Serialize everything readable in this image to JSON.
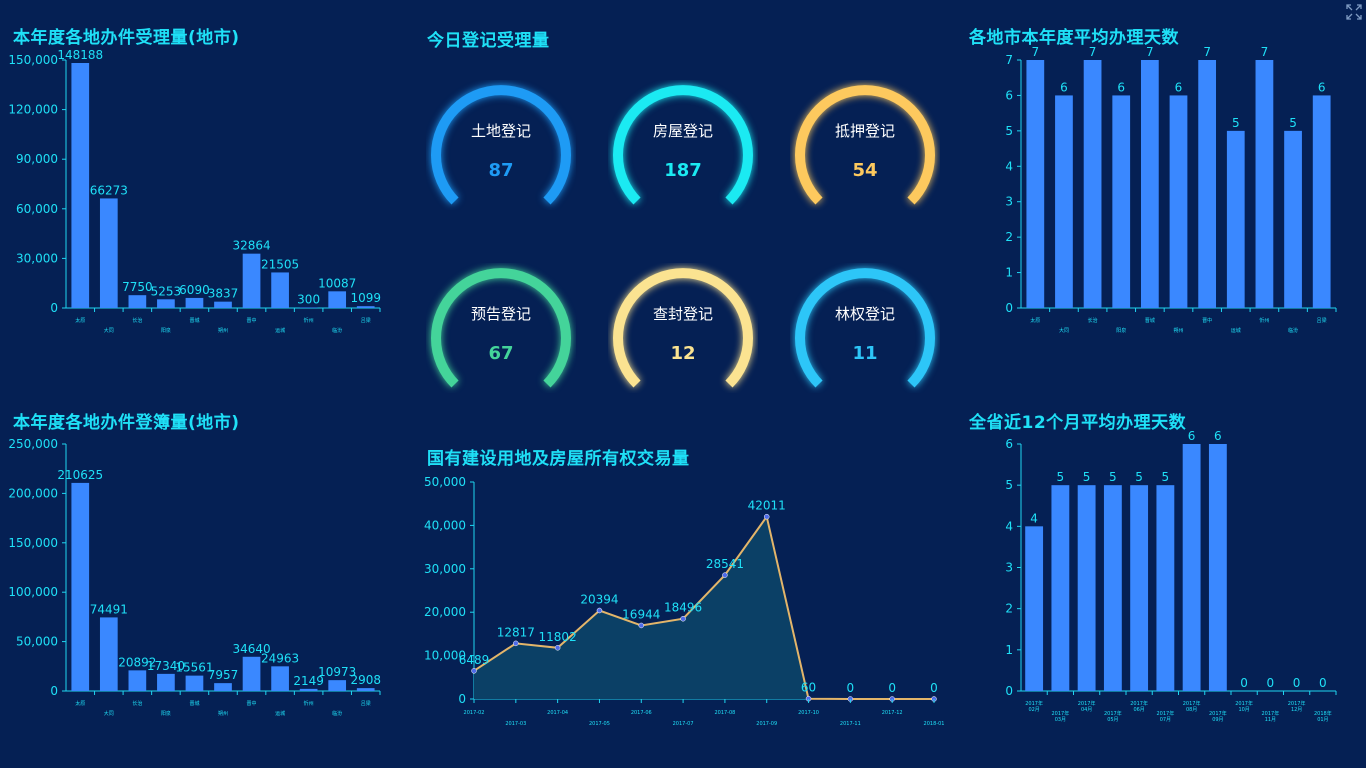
{
  "fullscreen_icon": "expand-arrows-icon",
  "colors": {
    "title": "#1FE0F7",
    "bar": "#3A88FF",
    "axis": "#1FD6F1",
    "label": "#1FE0F7",
    "line": "#E3B56A",
    "area": "#0B4066",
    "point": "#4F6BE8"
  },
  "panels": {
    "tl_title": "本年度各地办件受理量(地市)",
    "tc_title": "今日登记受理量",
    "tr_title": "各地市本年度平均办理天数",
    "bl_title": "本年度各地办件登簿量(地市)",
    "bc_title": "国有建设用地及房屋所有权交易量",
    "br_title": "全省近12个月平均办理天数"
  },
  "gauges": [
    {
      "label": "土地登记",
      "value": "87",
      "color": "#1E9BF5"
    },
    {
      "label": "房屋登记",
      "value": "187",
      "color": "#1BEAF2"
    },
    {
      "label": "抵押登记",
      "value": "54",
      "color": "#FDC95E"
    },
    {
      "label": "预告登记",
      "value": "67",
      "color": "#44D49A"
    },
    {
      "label": "查封登记",
      "value": "12",
      "color": "#FBE391"
    },
    {
      "label": "林权登记",
      "value": "11",
      "color": "#2DC6F8"
    }
  ],
  "chart_data": [
    {
      "id": "accept",
      "type": "bar",
      "categories": [
        "太原",
        "大同",
        "长治",
        "阳泉",
        "晋城",
        "朔州",
        "晋中",
        "运城",
        "忻州",
        "临汾",
        "吕梁"
      ],
      "values": [
        148188,
        66273,
        7750,
        5253,
        6090,
        3837,
        32864,
        21505,
        300,
        10087,
        1099
      ],
      "ylim": [
        0,
        150000
      ],
      "yticks": [
        "0",
        "30,000",
        "60,000",
        "90,000",
        "120,000",
        "150,000"
      ]
    },
    {
      "id": "avgdays_city",
      "type": "bar",
      "categories": [
        "太原",
        "大同",
        "长治",
        "阳泉",
        "晋城",
        "朔州",
        "晋中",
        "运城",
        "忻州",
        "临汾",
        "吕梁"
      ],
      "values": [
        7,
        6,
        7,
        6,
        7,
        6,
        7,
        5,
        7,
        5,
        6
      ],
      "ylim": [
        0,
        7
      ],
      "yticks": [
        "0",
        "1",
        "2",
        "3",
        "4",
        "5",
        "6",
        "7"
      ]
    },
    {
      "id": "register",
      "type": "bar",
      "categories": [
        "太原",
        "大同",
        "长治",
        "阳泉",
        "晋城",
        "朔州",
        "晋中",
        "运城",
        "忻州",
        "临汾",
        "吕梁"
      ],
      "values": [
        210625,
        74491,
        20892,
        17340,
        15561,
        7957,
        34640,
        24963,
        2149,
        10973,
        2908
      ],
      "ylim": [
        0,
        250000
      ],
      "yticks": [
        "0",
        "50,000",
        "100,000",
        "150,000",
        "200,000",
        "250,000"
      ]
    },
    {
      "id": "trade",
      "type": "area",
      "categories": [
        "2017-02",
        "2017-03",
        "2017-04",
        "2017-05",
        "2017-06",
        "2017-07",
        "2017-08",
        "2017-09",
        "2017-10",
        "2017-11",
        "2017-12",
        "2018-01"
      ],
      "values": [
        6489,
        12817,
        11802,
        20394,
        16944,
        18496,
        28541,
        42011,
        60,
        0,
        0,
        0
      ],
      "ylim": [
        0,
        50000
      ],
      "yticks": [
        "0",
        "10,000",
        "20,000",
        "30,000",
        "40,000",
        "50,000"
      ]
    },
    {
      "id": "avgdays_month",
      "type": "bar",
      "categories": [
        "2017年02月",
        "2017年03月",
        "2017年04月",
        "2017年05月",
        "2017年06月",
        "2017年07月",
        "2017年08月",
        "2017年09月",
        "2017年10月",
        "2017年11月",
        "2017年12月",
        "2018年01月"
      ],
      "values": [
        4,
        5,
        5,
        5,
        5,
        5,
        6,
        6,
        0,
        0,
        0,
        0
      ],
      "ylim": [
        0,
        6
      ],
      "yticks": [
        "0",
        "1",
        "2",
        "3",
        "4",
        "5",
        "6"
      ]
    }
  ]
}
